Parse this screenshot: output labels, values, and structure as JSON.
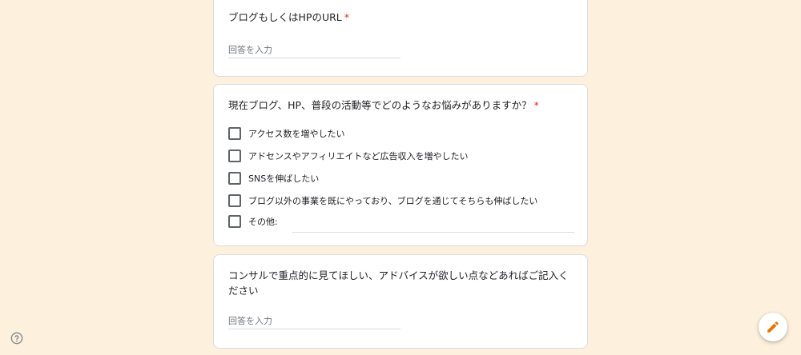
{
  "questions": {
    "blog_url": {
      "title": "ブログもしくはHPのURL",
      "required_mark": "*",
      "placeholder": "回答を入力"
    },
    "concerns": {
      "title": "現在ブログ、HP、普段の活動等でどのようなお悩みがありますか？",
      "required_mark": "*",
      "options": [
        "アクセス数を増やしたい",
        "アドセンスやアフィリエイトなど広告収入を増やしたい",
        "SNSを伸ばしたい",
        "ブログ以外の事業を既にやっており、ブログを通じてそちらも伸ばしたい",
        "その他:"
      ]
    },
    "advice": {
      "title": "コンサルで重点的に見てほしい、アドバイスが欲しい点などあればご記入ください",
      "placeholder": "回答を入力"
    }
  },
  "colors": {
    "page_background": "#fdf0dc",
    "required": "#d93025",
    "edit_icon": "#e37400"
  },
  "icons": {
    "help": "help-circle-icon",
    "edit": "pencil-icon"
  }
}
